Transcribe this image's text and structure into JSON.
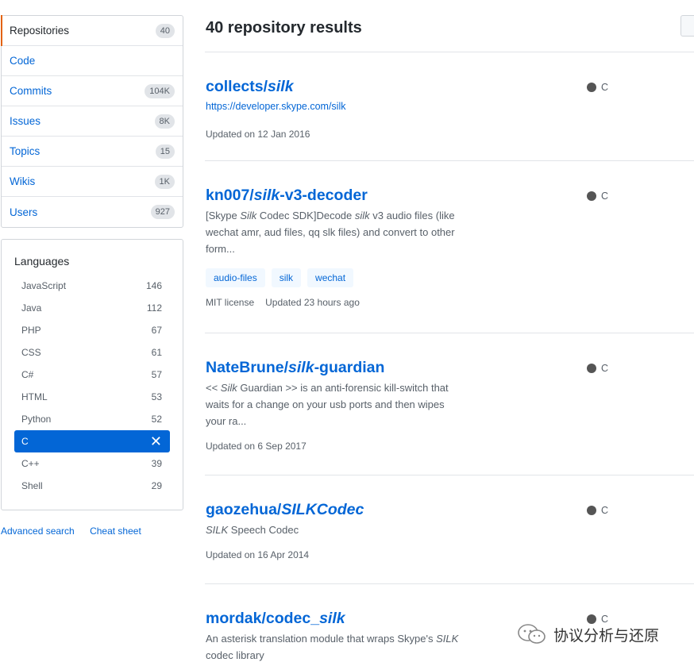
{
  "filter_menu": [
    {
      "label": "Repositories",
      "count": "40",
      "selected": true
    },
    {
      "label": "Code",
      "count": ""
    },
    {
      "label": "Commits",
      "count": "104K"
    },
    {
      "label": "Issues",
      "count": "8K"
    },
    {
      "label": "Topics",
      "count": "15"
    },
    {
      "label": "Wikis",
      "count": "1K"
    },
    {
      "label": "Users",
      "count": "927"
    }
  ],
  "languages": {
    "title": "Languages",
    "items": [
      {
        "name": "JavaScript",
        "count": "146"
      },
      {
        "name": "Java",
        "count": "112"
      },
      {
        "name": "PHP",
        "count": "67"
      },
      {
        "name": "CSS",
        "count": "61"
      },
      {
        "name": "C#",
        "count": "57"
      },
      {
        "name": "HTML",
        "count": "53"
      },
      {
        "name": "Python",
        "count": "52"
      },
      {
        "name": "C",
        "count": "",
        "active": true,
        "clear_glyph": "✕"
      },
      {
        "name": "C++",
        "count": "39"
      },
      {
        "name": "Shell",
        "count": "29"
      }
    ]
  },
  "links": {
    "advanced": "Advanced search",
    "cheat": "Cheat sheet"
  },
  "results_title": "40 repository results",
  "repos": [
    {
      "owner": "collects/",
      "name_parts": [
        {
          "t": "silk",
          "em": true
        }
      ],
      "desc_url": "https://developer.skype.com/silk",
      "meta": [
        "Updated on 12 Jan 2016"
      ],
      "lang": "C"
    },
    {
      "owner": "kn007/",
      "name_parts": [
        {
          "t": "silk",
          "em": true
        },
        {
          "t": "-v3-decoder",
          "em": false
        }
      ],
      "desc": "[Skype Silk Codec SDK]Decode silk v3 audio files (like wechat amr, aud files, qq slk files) and convert to other form...",
      "topics": [
        "audio-files",
        "silk",
        "wechat"
      ],
      "meta": [
        "MIT license",
        "Updated 23 hours ago"
      ],
      "lang": "C"
    },
    {
      "owner": "NateBrune/",
      "name_parts": [
        {
          "t": "silk",
          "em": true
        },
        {
          "t": "-guardian",
          "em": false
        }
      ],
      "desc": "<< Silk Guardian >> is an anti-forensic kill-switch that waits for a change on your usb ports and then wipes your ra...",
      "meta": [
        "Updated on 6 Sep 2017"
      ],
      "lang": "C"
    },
    {
      "owner": "gaozehua/",
      "name_parts": [
        {
          "t": "SILKCodec",
          "em": true
        }
      ],
      "desc": "SILK Speech Codec",
      "meta": [
        "Updated on 16 Apr 2014"
      ],
      "lang": "C"
    },
    {
      "owner": "mordak/",
      "name_parts": [
        {
          "t": "codec_",
          "em": false
        },
        {
          "t": "silk",
          "em": true
        }
      ],
      "desc": "An asterisk translation module that wraps Skype's SILK codec library",
      "meta": [],
      "lang": "C"
    }
  ],
  "watermark": "协议分析与还原"
}
